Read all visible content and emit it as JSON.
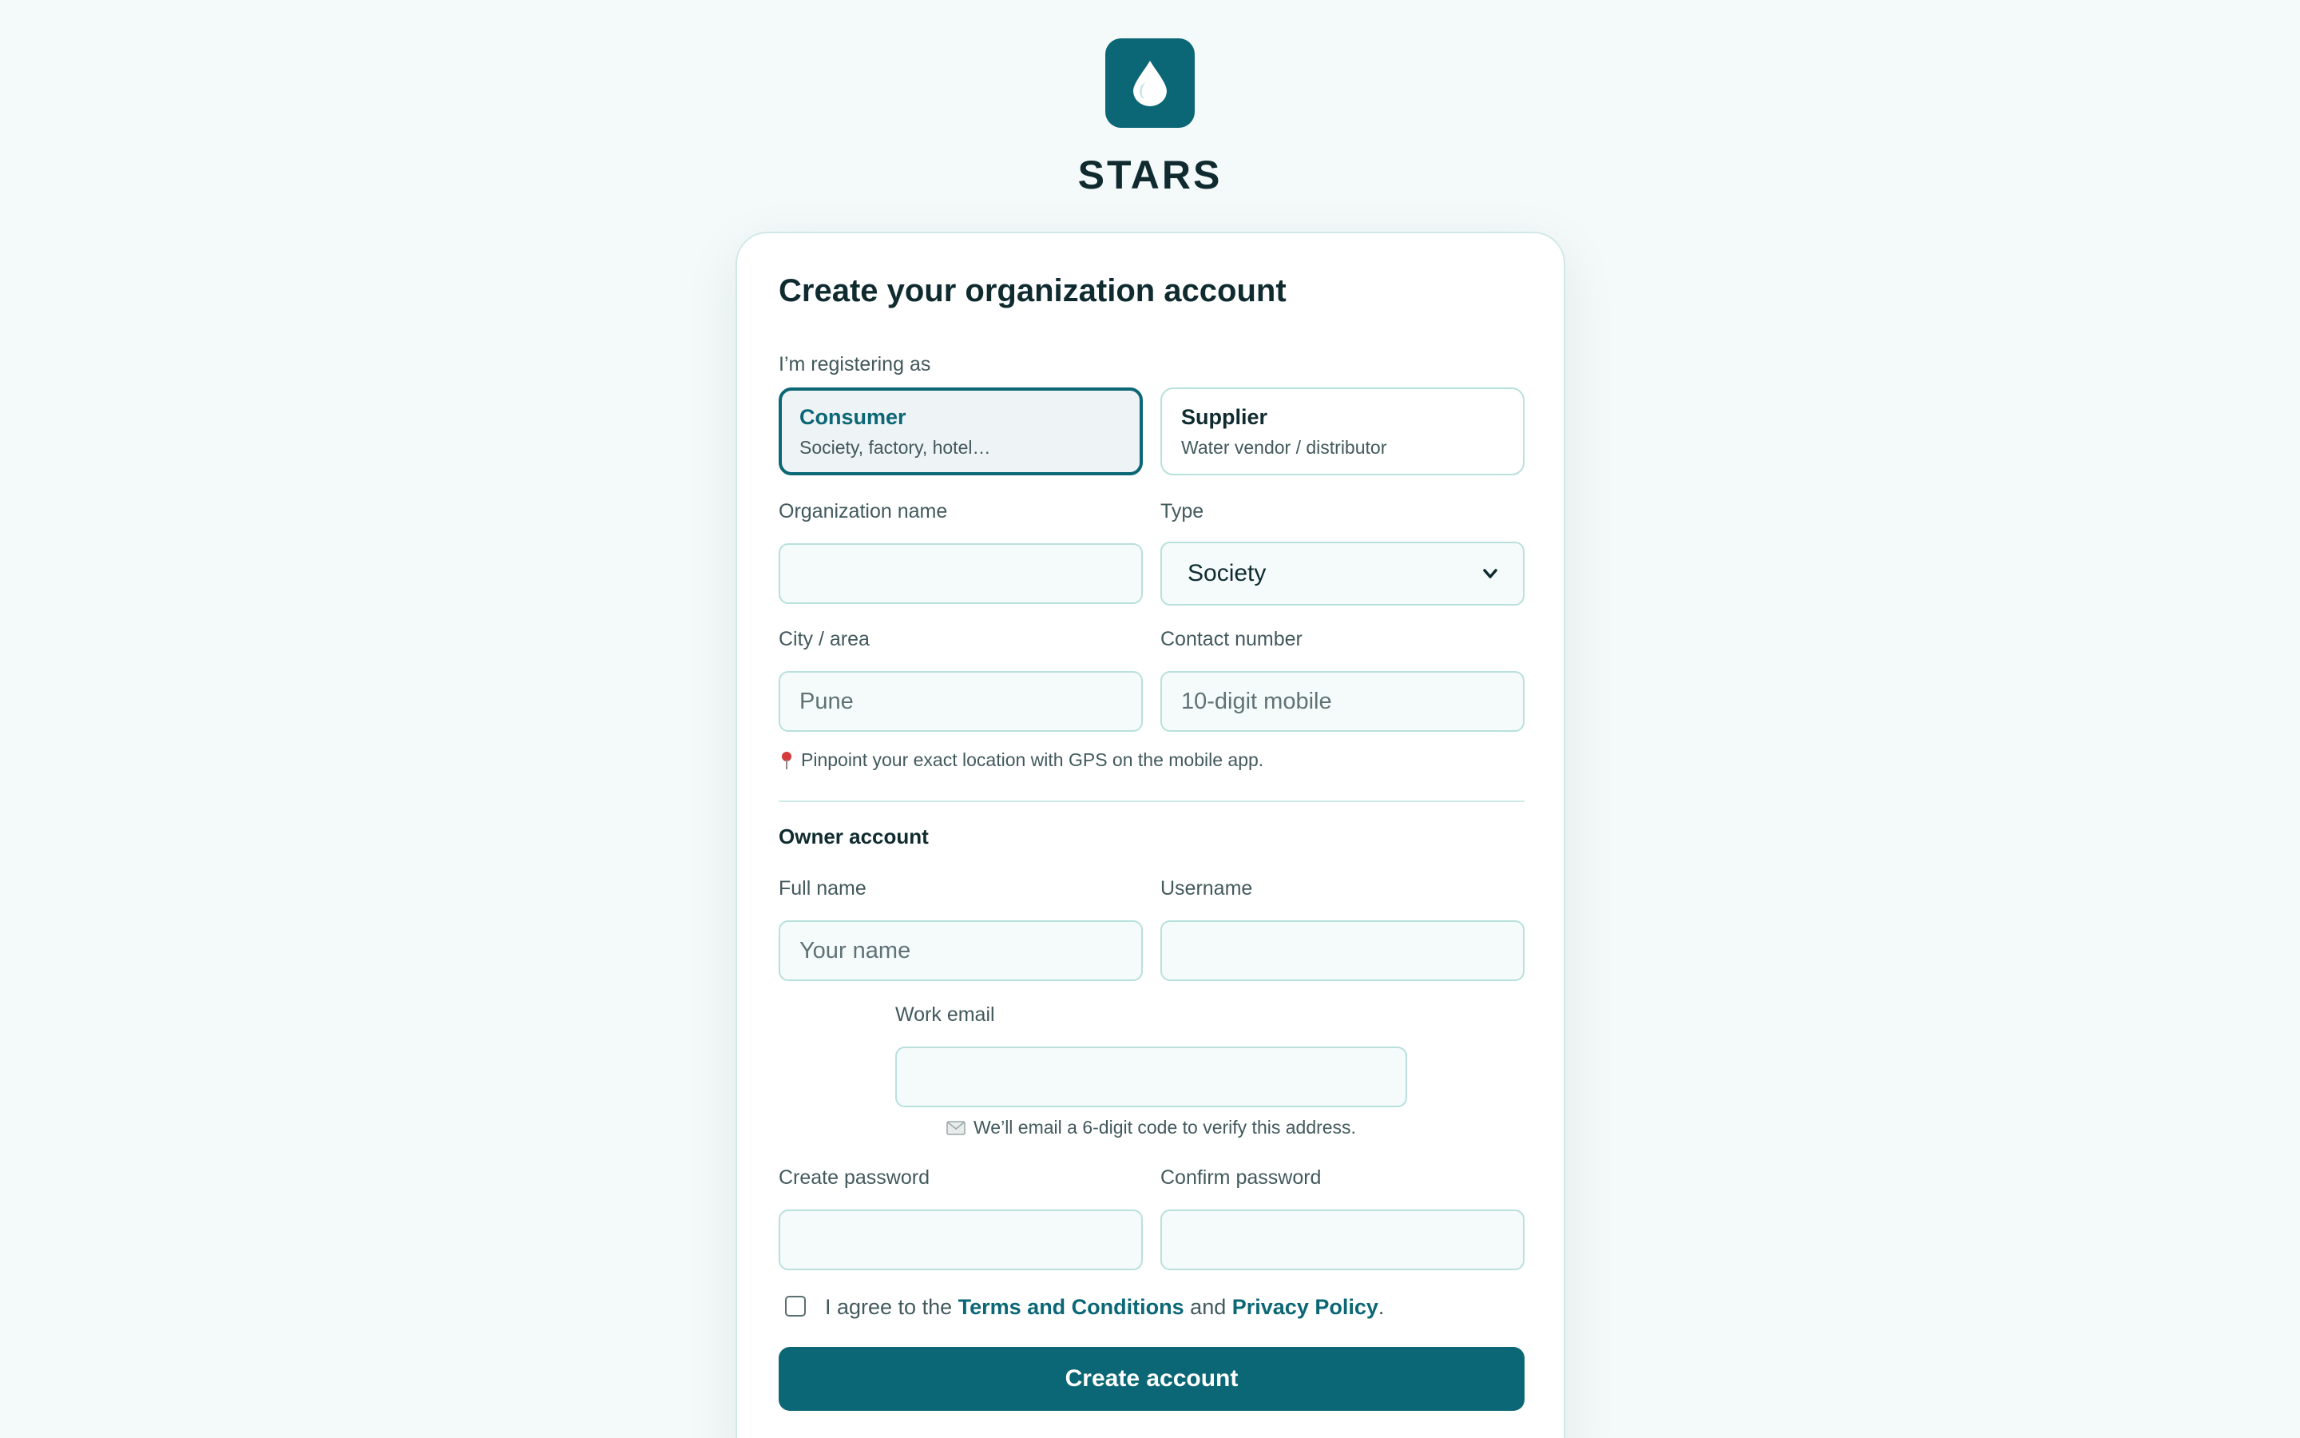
{
  "brand": {
    "name": "STARS",
    "logo_icon": "water-drop-icon",
    "accent": "#0b6775"
  },
  "form": {
    "title": "Create your organization account",
    "role_label": "I’m registering as",
    "roles": [
      {
        "title": "Consumer",
        "subtitle": "Society, factory, hotel…",
        "selected": true
      },
      {
        "title": "Supplier",
        "subtitle": "Water vendor / distributor",
        "selected": false
      }
    ],
    "org_name": {
      "label": "Organization name",
      "placeholder": "",
      "value": ""
    },
    "type": {
      "label": "Type",
      "value": "Society"
    },
    "city": {
      "label": "City / area",
      "placeholder": "Pune",
      "value": ""
    },
    "contact": {
      "label": "Contact number",
      "placeholder": "10-digit mobile",
      "value": ""
    },
    "gps_hint": {
      "icon": "pin-icon",
      "text": "Pinpoint your exact location with GPS on the mobile app."
    },
    "owner_section": "Owner account",
    "full_name": {
      "label": "Full name",
      "placeholder": "Your name",
      "value": ""
    },
    "username": {
      "label": "Username",
      "placeholder": "",
      "value": ""
    },
    "email": {
      "label": "Work email",
      "placeholder": "",
      "value": ""
    },
    "email_hint": {
      "icon": "envelope-icon",
      "text": "We’ll email a 6-digit code to verify this address."
    },
    "password": {
      "label": "Create password",
      "value": ""
    },
    "confirm_password": {
      "label": "Confirm password",
      "value": ""
    },
    "agree": {
      "prefix": "I agree to the",
      "terms": "Terms and Conditions",
      "middle": "and",
      "privacy": "Privacy Policy",
      "suffix": ".",
      "checked": false
    },
    "submit_label": "Create account"
  }
}
